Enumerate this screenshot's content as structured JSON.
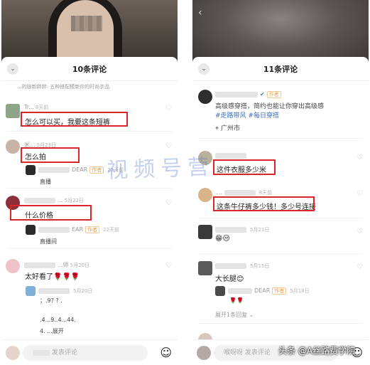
{
  "left": {
    "header_title": "10条评论",
    "partial_top": "...的版新胖胖: 五种搭配模新你的时尚衣品",
    "comments": [
      {
        "username": "Tr...",
        "date": "8天前",
        "text": "怎么可以买，我要这条短裤"
      },
      {
        "username": "米...",
        "date": "5月23日",
        "text": "怎么拍",
        "reply_user": "DEAR",
        "reply_tag": "作者",
        "reply_date": "22天前",
        "reply_text": "直播"
      },
      {
        "username": "...",
        "date": "5月22日",
        "text": "什么价格",
        "reply_user": "EAR",
        "reply_tag": "作者",
        "reply_date": "22天前",
        "reply_text": "直播间"
      },
      {
        "username": "...师",
        "date": "5月20日",
        "text": "太好看了🌹🌹🌹",
        "reply_date": "5月20日",
        "reply_text": "；.9? ? .",
        "extra1": ".4...9..4...44.",
        "extra2": "4. ...展开"
      }
    ],
    "input_placeholder": "发表评论"
  },
  "right": {
    "header_title": "11条评论",
    "author_tag": "作者",
    "author_text_1": "高级感穿搭，简约也能让你穿出高级感",
    "author_tag_link": "#走路带风 #每日穿搭",
    "location": "广州市",
    "comments": [
      {
        "text": "这件衣服多少米"
      },
      {
        "username": "....",
        "date": "8天前",
        "text": "这条牛仔裤多少钱！多少号连接"
      },
      {
        "date": "5月21日",
        "text": "😁😒"
      },
      {
        "date": "5月15日",
        "text": "大长腿😊",
        "reply_user": "DEAR",
        "reply_tag": "作者",
        "reply_date": "5月18日",
        "reply_text": "🌹🌹",
        "expand": "展开1条回复"
      }
    ],
    "input_placeholder": "喉呀呀 发表评论"
  },
  "watermark": "视频号营",
  "credit": "头条 @A丝路费学院",
  "icons": {
    "collapse": "chevron-down-icon",
    "heart": "heart-icon",
    "emoji": "emoji-icon",
    "location": "location-pin-icon",
    "verified": "verified-icon"
  },
  "colors": {
    "highlight": "#d8262b",
    "author_tag": "#e8a04a",
    "hashtag": "#3a6fb8"
  }
}
